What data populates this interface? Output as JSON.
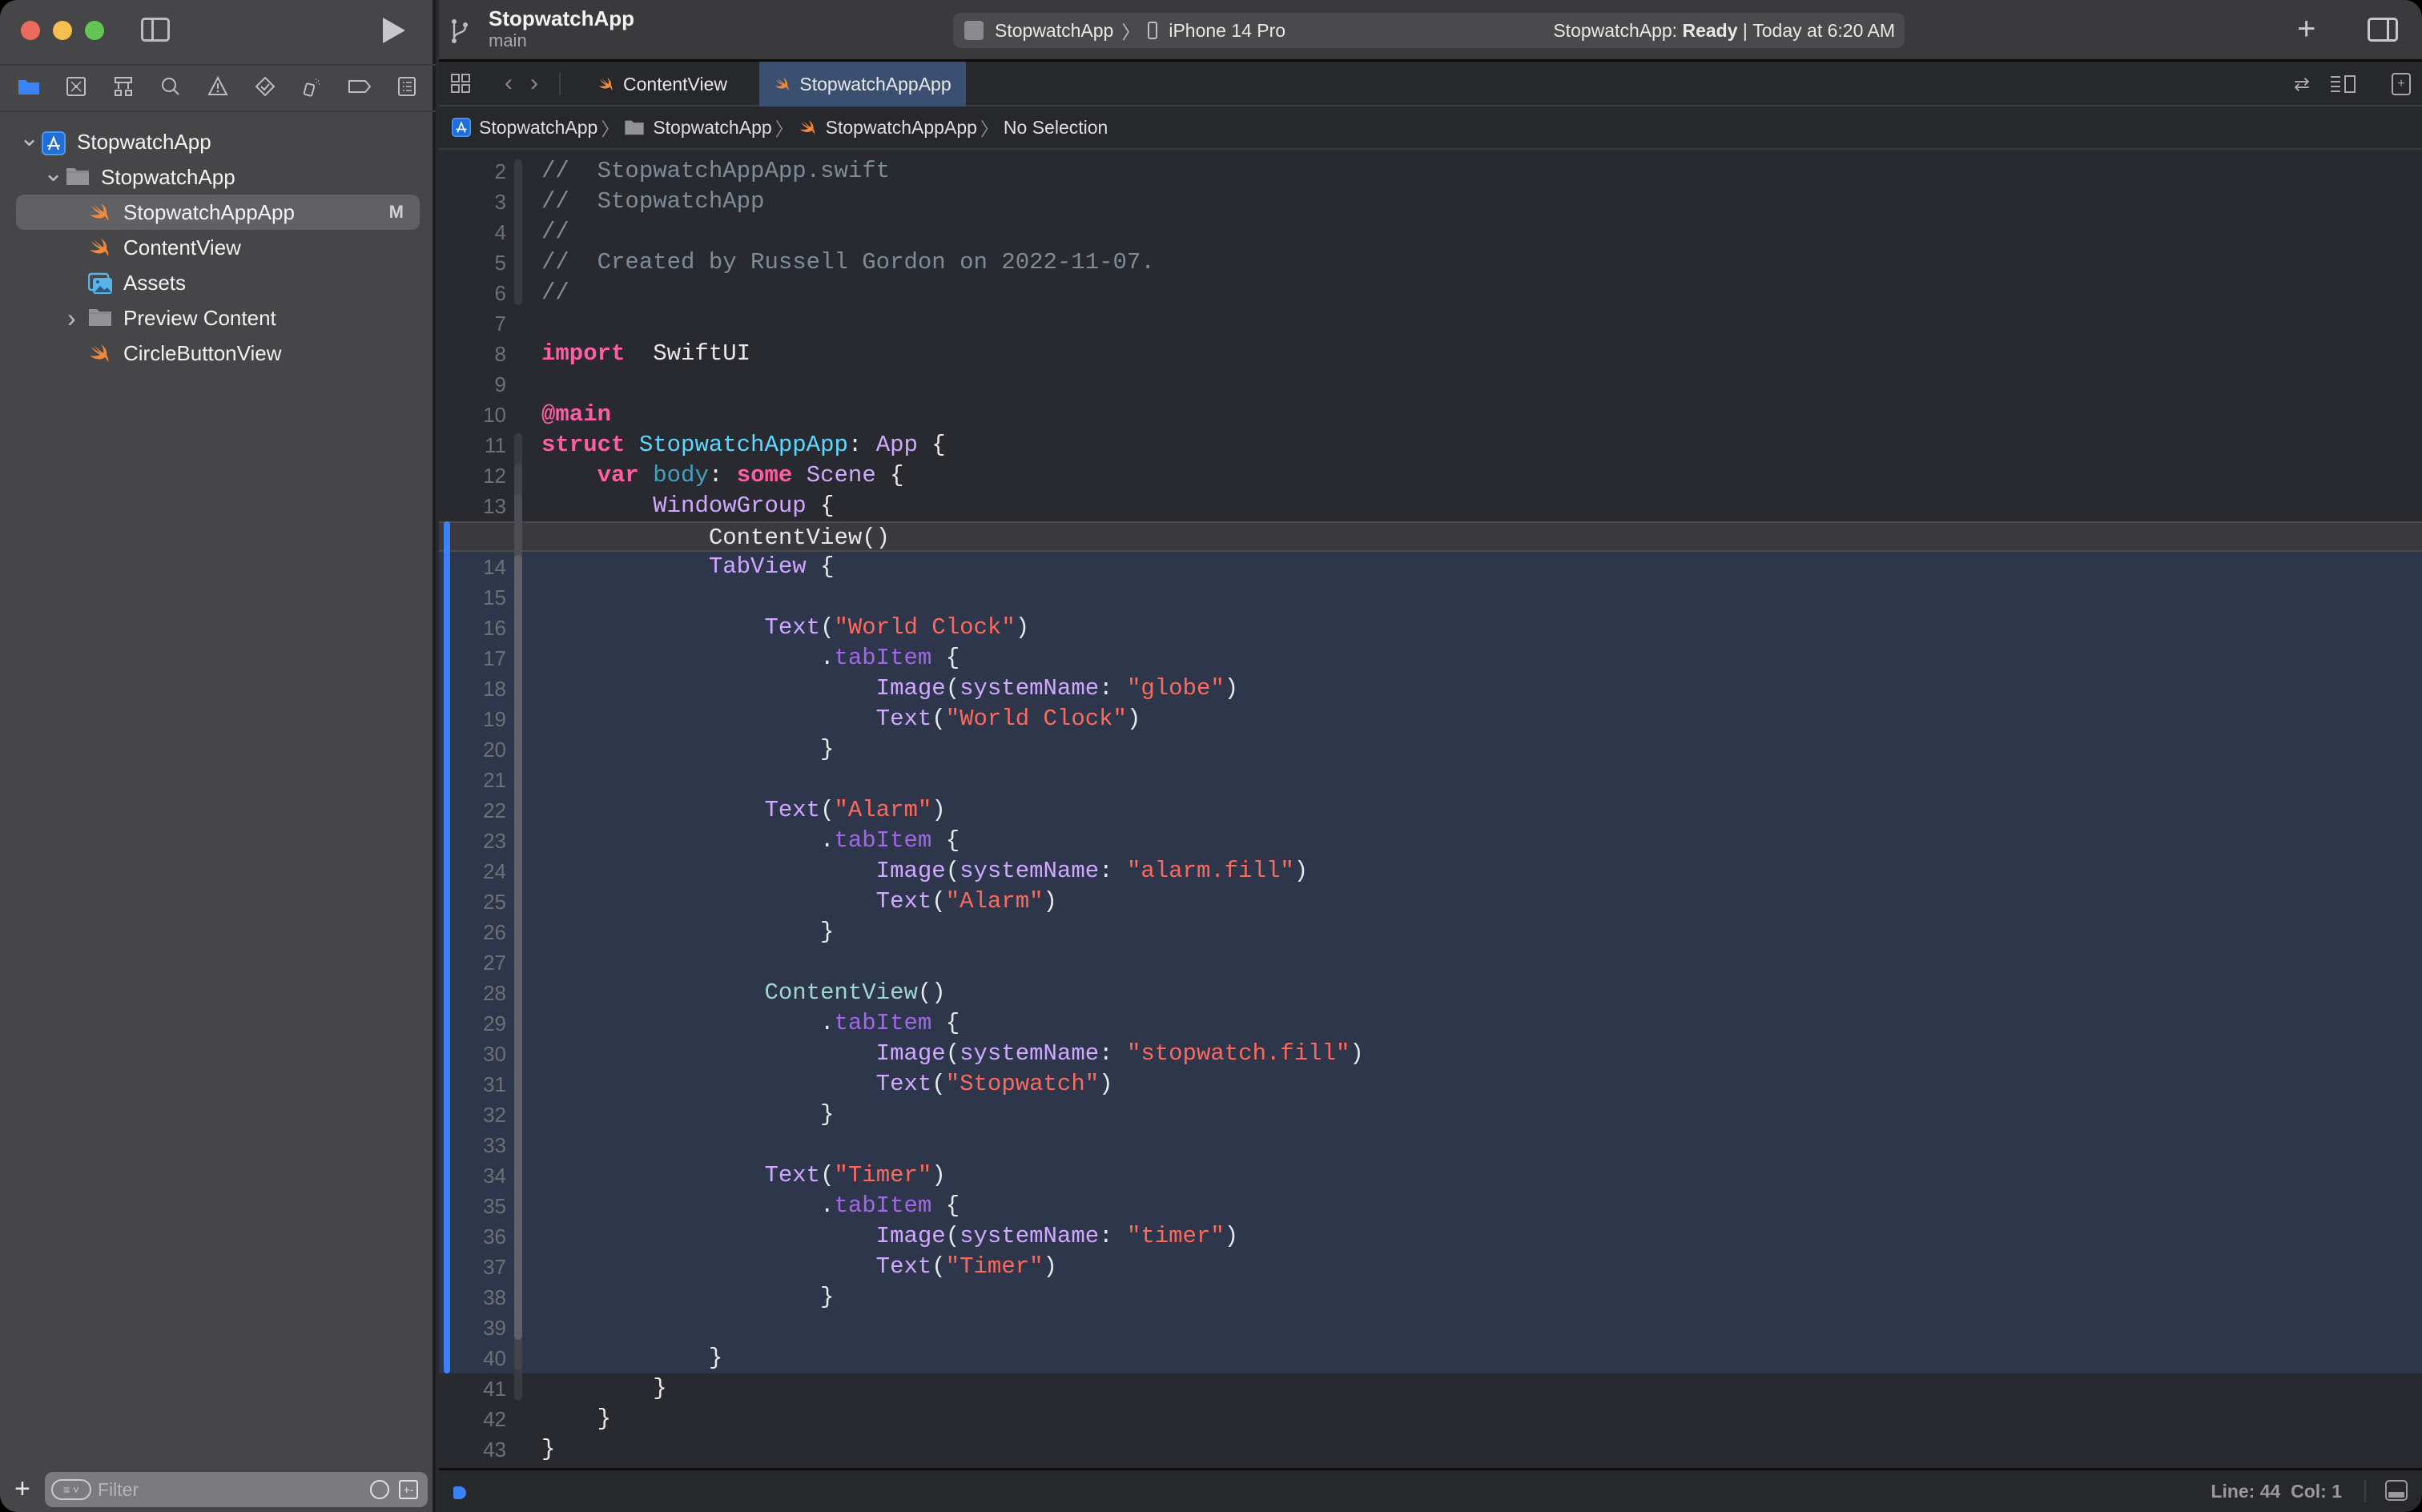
{
  "window": {
    "traffic_lights": [
      {
        "name": "close",
        "color": "#ee6a5f"
      },
      {
        "name": "minimize",
        "color": "#f5be4f"
      },
      {
        "name": "zoom",
        "color": "#62c554"
      }
    ]
  },
  "toolbar": {
    "project_title": "StopwatchApp",
    "branch": "main",
    "scheme": "StopwatchApp",
    "destination": "iPhone 14 Pro",
    "status_prefix": "StopwatchApp: ",
    "status_state": "Ready",
    "status_sep": " | ",
    "status_time": "Today at 6:20 AM"
  },
  "navigator_tabs": [
    "project-navigator",
    "source-control-navigator",
    "symbol-navigator",
    "find-navigator",
    "issue-navigator",
    "test-navigator",
    "debug-navigator",
    "breakpoint-navigator",
    "report-navigator"
  ],
  "tree": [
    {
      "label": "StopwatchApp",
      "kind": "project",
      "level": 0,
      "expanded": true
    },
    {
      "label": "StopwatchApp",
      "kind": "folder",
      "level": 1,
      "expanded": true
    },
    {
      "label": "StopwatchAppApp",
      "kind": "swift",
      "level": 2,
      "selected": true,
      "badge": "M"
    },
    {
      "label": "ContentView",
      "kind": "swift",
      "level": 2
    },
    {
      "label": "Assets",
      "kind": "assets",
      "level": 2
    },
    {
      "label": "Preview Content",
      "kind": "folder",
      "level": 2,
      "expanded": false
    },
    {
      "label": "CircleButtonView",
      "kind": "swift",
      "level": 2
    }
  ],
  "filter": {
    "placeholder": "Filter"
  },
  "tabs": [
    {
      "label": "ContentView",
      "active": false
    },
    {
      "label": "StopwatchAppApp",
      "active": true
    }
  ],
  "breadcrumb": [
    "StopwatchApp",
    "StopwatchApp",
    "StopwatchAppApp",
    "No Selection"
  ],
  "code_lines": [
    {
      "n": "2",
      "tokens": [
        [
          "c-com",
          "//  StopwatchAppApp.swift"
        ]
      ]
    },
    {
      "n": "3",
      "tokens": [
        [
          "c-com",
          "//  StopwatchApp"
        ]
      ]
    },
    {
      "n": "4",
      "tokens": [
        [
          "c-com",
          "//"
        ]
      ]
    },
    {
      "n": "5",
      "tokens": [
        [
          "c-com",
          "//  Created by Russell Gordon on 2022-11-07."
        ]
      ]
    },
    {
      "n": "6",
      "tokens": [
        [
          "c-com",
          "//"
        ]
      ]
    },
    {
      "n": "7",
      "tokens": []
    },
    {
      "n": "8",
      "tokens": [
        [
          "c-kw",
          "import"
        ],
        [
          "",
          "  SwiftUI"
        ]
      ]
    },
    {
      "n": "9",
      "tokens": []
    },
    {
      "n": "10",
      "tokens": [
        [
          "c-kw",
          "@main"
        ]
      ]
    },
    {
      "n": "11",
      "tokens": [
        [
          "c-kw",
          "struct"
        ],
        [
          "",
          " "
        ],
        [
          "c-decl",
          "StopwatchAppApp"
        ],
        [
          "",
          ": "
        ],
        [
          "c-type",
          "App"
        ],
        [
          "",
          " {"
        ]
      ]
    },
    {
      "n": "12",
      "tokens": [
        [
          "",
          "    "
        ],
        [
          "c-kw",
          "var"
        ],
        [
          "",
          " "
        ],
        [
          "c-var",
          "body"
        ],
        [
          "",
          ": "
        ],
        [
          "c-kw",
          "some"
        ],
        [
          "",
          " "
        ],
        [
          "c-type",
          "Scene"
        ],
        [
          "",
          " {"
        ]
      ]
    },
    {
      "n": "13",
      "tokens": [
        [
          "",
          "        "
        ],
        [
          "c-type",
          "WindowGroup"
        ],
        [
          "",
          " {"
        ]
      ]
    },
    {
      "n": "",
      "deleted": true,
      "tokens": [
        [
          "",
          "            ContentView()"
        ]
      ]
    },
    {
      "n": "14",
      "hl": true,
      "tokens": [
        [
          "",
          "            "
        ],
        [
          "c-type",
          "TabView"
        ],
        [
          "",
          " {"
        ]
      ]
    },
    {
      "n": "15",
      "hl": true,
      "tokens": []
    },
    {
      "n": "16",
      "hl": true,
      "tokens": [
        [
          "",
          "                "
        ],
        [
          "c-type",
          "Text"
        ],
        [
          "",
          "("
        ],
        [
          "c-str",
          "\"World Clock\""
        ],
        [
          "",
          ")"
        ]
      ]
    },
    {
      "n": "17",
      "hl": true,
      "tokens": [
        [
          "",
          "                    ."
        ],
        [
          "c-prop",
          "tabItem"
        ],
        [
          "",
          " {"
        ]
      ]
    },
    {
      "n": "18",
      "hl": true,
      "tokens": [
        [
          "",
          "                        "
        ],
        [
          "c-type",
          "Image"
        ],
        [
          "",
          "("
        ],
        [
          "c-type",
          "systemName"
        ],
        [
          "",
          ": "
        ],
        [
          "c-str",
          "\"globe\""
        ],
        [
          "",
          ")"
        ]
      ]
    },
    {
      "n": "19",
      "hl": true,
      "tokens": [
        [
          "",
          "                        "
        ],
        [
          "c-type",
          "Text"
        ],
        [
          "",
          "("
        ],
        [
          "c-str",
          "\"World Clock\""
        ],
        [
          "",
          ")"
        ]
      ]
    },
    {
      "n": "20",
      "hl": true,
      "tokens": [
        [
          "",
          "                    }"
        ]
      ]
    },
    {
      "n": "21",
      "hl": true,
      "tokens": []
    },
    {
      "n": "22",
      "hl": true,
      "tokens": [
        [
          "",
          "                "
        ],
        [
          "c-type",
          "Text"
        ],
        [
          "",
          "("
        ],
        [
          "c-str",
          "\"Alarm\""
        ],
        [
          "",
          ")"
        ]
      ]
    },
    {
      "n": "23",
      "hl": true,
      "tokens": [
        [
          "",
          "                    ."
        ],
        [
          "c-prop",
          "tabItem"
        ],
        [
          "",
          " {"
        ]
      ]
    },
    {
      "n": "24",
      "hl": true,
      "tokens": [
        [
          "",
          "                        "
        ],
        [
          "c-type",
          "Image"
        ],
        [
          "",
          "("
        ],
        [
          "c-type",
          "systemName"
        ],
        [
          "",
          ": "
        ],
        [
          "c-str",
          "\"alarm.fill\""
        ],
        [
          "",
          ")"
        ]
      ]
    },
    {
      "n": "25",
      "hl": true,
      "tokens": [
        [
          "",
          "                        "
        ],
        [
          "c-type",
          "Text"
        ],
        [
          "",
          "("
        ],
        [
          "c-str",
          "\"Alarm\""
        ],
        [
          "",
          ")"
        ]
      ]
    },
    {
      "n": "26",
      "hl": true,
      "tokens": [
        [
          "",
          "                    }"
        ]
      ]
    },
    {
      "n": "27",
      "hl": true,
      "tokens": []
    },
    {
      "n": "28",
      "hl": true,
      "tokens": [
        [
          "",
          "                "
        ],
        [
          "c-fn",
          "ContentView"
        ],
        [
          "",
          "()"
        ]
      ]
    },
    {
      "n": "29",
      "hl": true,
      "tokens": [
        [
          "",
          "                    ."
        ],
        [
          "c-prop",
          "tabItem"
        ],
        [
          "",
          " {"
        ]
      ]
    },
    {
      "n": "30",
      "hl": true,
      "tokens": [
        [
          "",
          "                        "
        ],
        [
          "c-type",
          "Image"
        ],
        [
          "",
          "("
        ],
        [
          "c-type",
          "systemName"
        ],
        [
          "",
          ": "
        ],
        [
          "c-str",
          "\"stopwatch.fill\""
        ],
        [
          "",
          ")"
        ]
      ]
    },
    {
      "n": "31",
      "hl": true,
      "tokens": [
        [
          "",
          "                        "
        ],
        [
          "c-type",
          "Text"
        ],
        [
          "",
          "("
        ],
        [
          "c-str",
          "\"Stopwatch\""
        ],
        [
          "",
          ")"
        ]
      ]
    },
    {
      "n": "32",
      "hl": true,
      "tokens": [
        [
          "",
          "                    }"
        ]
      ]
    },
    {
      "n": "33",
      "hl": true,
      "tokens": []
    },
    {
      "n": "34",
      "hl": true,
      "tokens": [
        [
          "",
          "                "
        ],
        [
          "c-type",
          "Text"
        ],
        [
          "",
          "("
        ],
        [
          "c-str",
          "\"Timer\""
        ],
        [
          "",
          ")"
        ]
      ]
    },
    {
      "n": "35",
      "hl": true,
      "tokens": [
        [
          "",
          "                    ."
        ],
        [
          "c-prop",
          "tabItem"
        ],
        [
          "",
          " {"
        ]
      ]
    },
    {
      "n": "36",
      "hl": true,
      "tokens": [
        [
          "",
          "                        "
        ],
        [
          "c-type",
          "Image"
        ],
        [
          "",
          "("
        ],
        [
          "c-type",
          "systemName"
        ],
        [
          "",
          ": "
        ],
        [
          "c-str",
          "\"timer\""
        ],
        [
          "",
          ")"
        ]
      ]
    },
    {
      "n": "37",
      "hl": true,
      "tokens": [
        [
          "",
          "                        "
        ],
        [
          "c-type",
          "Text"
        ],
        [
          "",
          "("
        ],
        [
          "c-str",
          "\"Timer\""
        ],
        [
          "",
          ")"
        ]
      ]
    },
    {
      "n": "38",
      "hl": true,
      "tokens": [
        [
          "",
          "                    }"
        ]
      ]
    },
    {
      "n": "39",
      "hl": true,
      "tokens": []
    },
    {
      "n": "40",
      "hl": true,
      "tokens": [
        [
          "",
          "            }"
        ]
      ]
    },
    {
      "n": "41",
      "tokens": [
        [
          "",
          "        }"
        ]
      ]
    },
    {
      "n": "42",
      "tokens": [
        [
          "",
          "    }"
        ]
      ]
    },
    {
      "n": "43",
      "tokens": [
        [
          "",
          "}"
        ]
      ]
    }
  ],
  "status_bar": {
    "line_label": "Line: 44",
    "col_label": "Col: 1"
  },
  "colors": {
    "accent": "#3b82f6",
    "swift_icon": "#f0883e",
    "selection_bg": "#2d364b",
    "active_tab": "#3b5070"
  }
}
